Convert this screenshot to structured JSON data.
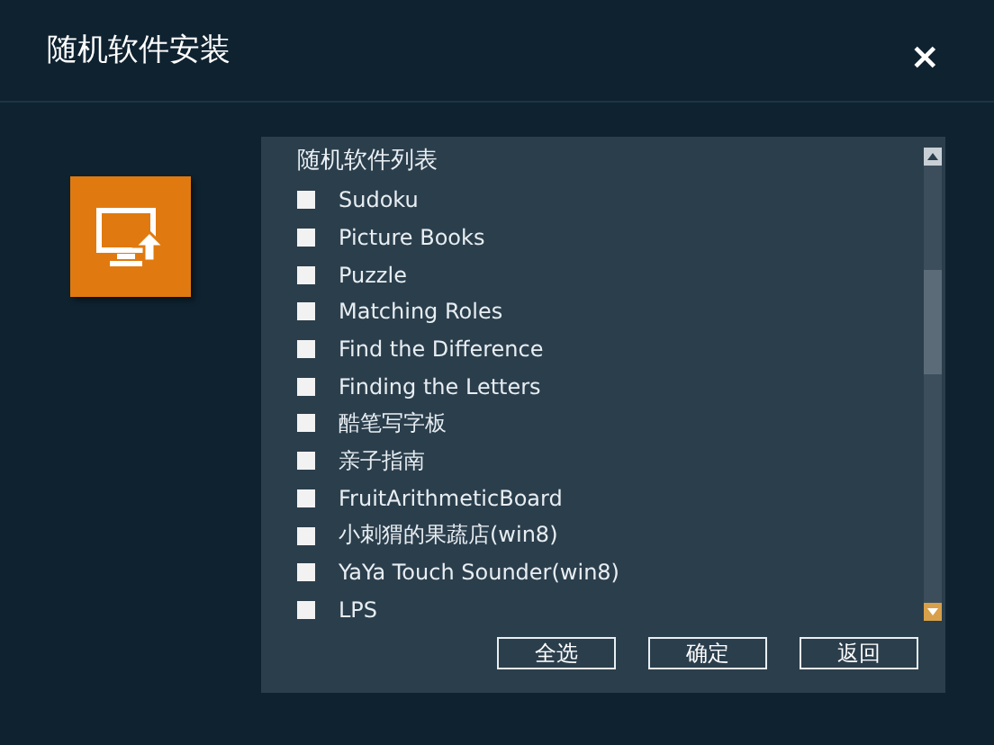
{
  "window": {
    "title": "随机软件安装",
    "close": "×"
  },
  "list": {
    "heading": "随机软件列表",
    "items": [
      {
        "label": "Sudoku",
        "checked": false
      },
      {
        "label": "Picture Books",
        "checked": false
      },
      {
        "label": "Puzzle",
        "checked": false
      },
      {
        "label": "Matching Roles",
        "checked": false
      },
      {
        "label": "Find the Difference",
        "checked": false
      },
      {
        "label": "Finding the Letters",
        "checked": false
      },
      {
        "label": "酷笔写字板",
        "checked": false
      },
      {
        "label": "亲子指南",
        "checked": false
      },
      {
        "label": "FruitArithmeticBoard",
        "checked": false
      },
      {
        "label": "小刺猬的果蔬店(win8)",
        "checked": false
      },
      {
        "label": "YaYa Touch Sounder(win8)",
        "checked": false
      },
      {
        "label": "LPS",
        "checked": false
      }
    ]
  },
  "buttons": [
    "全选",
    "确定",
    "返回"
  ]
}
